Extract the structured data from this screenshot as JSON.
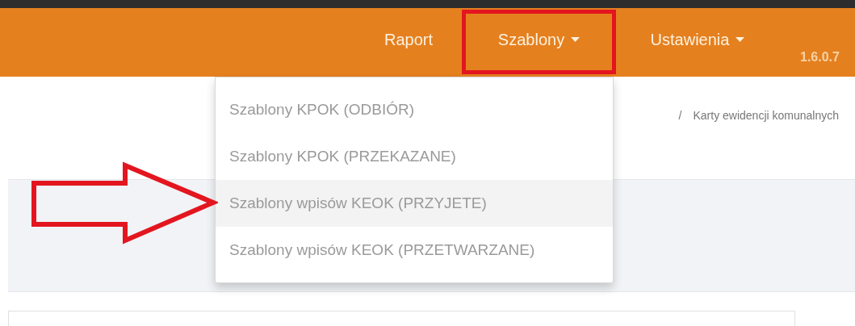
{
  "navbar": {
    "items": [
      {
        "label": "Raport",
        "kind": "link"
      },
      {
        "label": "Szablony",
        "kind": "dropdown"
      },
      {
        "label": "Ustawienia",
        "kind": "dropdown"
      }
    ],
    "version": "1.6.0.7"
  },
  "breadcrumb": {
    "separator": "/",
    "current": "Karty ewidencji komunalnych"
  },
  "dropdown": {
    "items": [
      {
        "label": "Szablony KPOK (ODBIÓR)",
        "selected": false
      },
      {
        "label": "Szablony KPOK (PRZEKAZANE)",
        "selected": false
      },
      {
        "label": "Szablony wpisów KEOK (PRZYJETE)",
        "selected": true
      },
      {
        "label": "Szablony wpisów KEOK (PRZETWARZANE)",
        "selected": false
      }
    ]
  }
}
